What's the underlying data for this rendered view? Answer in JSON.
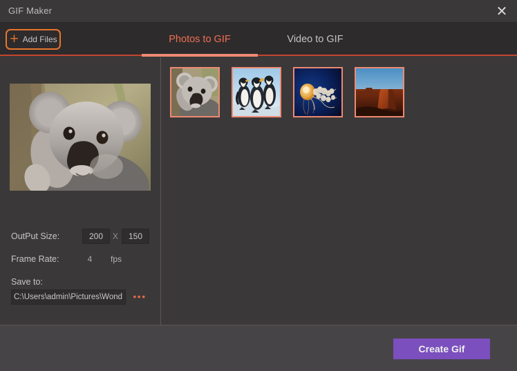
{
  "window": {
    "title": "GIF Maker",
    "close_icon": "close-icon",
    "close_glyph": "✕"
  },
  "toolbar": {
    "add_files_label": "Add Files",
    "add_files_icon": "plus-icon",
    "add_files_glyph": "+",
    "tabs": [
      {
        "label": "Photos to GIF",
        "active": true
      },
      {
        "label": "Video to GIF",
        "active": false
      }
    ]
  },
  "left_panel": {
    "preview_alt": "koala-preview",
    "output_size": {
      "label": "OutPut Size:",
      "width": "200",
      "separator": "X",
      "height": "150"
    },
    "frame_rate": {
      "label": "Frame Rate:",
      "value": "4",
      "unit": "fps"
    },
    "save_to": {
      "label": "Save to:",
      "path": "C:\\Users\\admin\\Pictures\\Wond",
      "browse_label": "•••"
    }
  },
  "thumbnails": [
    {
      "name": "koala-thumbnail",
      "selected": true
    },
    {
      "name": "penguins-thumbnail",
      "selected": true
    },
    {
      "name": "jellyfish-thumbnail",
      "selected": true
    },
    {
      "name": "desert-butte-thumbnail",
      "selected": true
    }
  ],
  "footer": {
    "create_label": "Create Gif"
  },
  "colors": {
    "accent_orange": "#e8762c",
    "accent_salmon": "#ef8a72",
    "tab_active": "#ef6f52",
    "rule_red": "#c4452f",
    "create_purple": "#7b4fbd",
    "window_bg": "#3b3839",
    "tabbar_bg": "#2e2b2c",
    "footer_bg": "#474447"
  }
}
